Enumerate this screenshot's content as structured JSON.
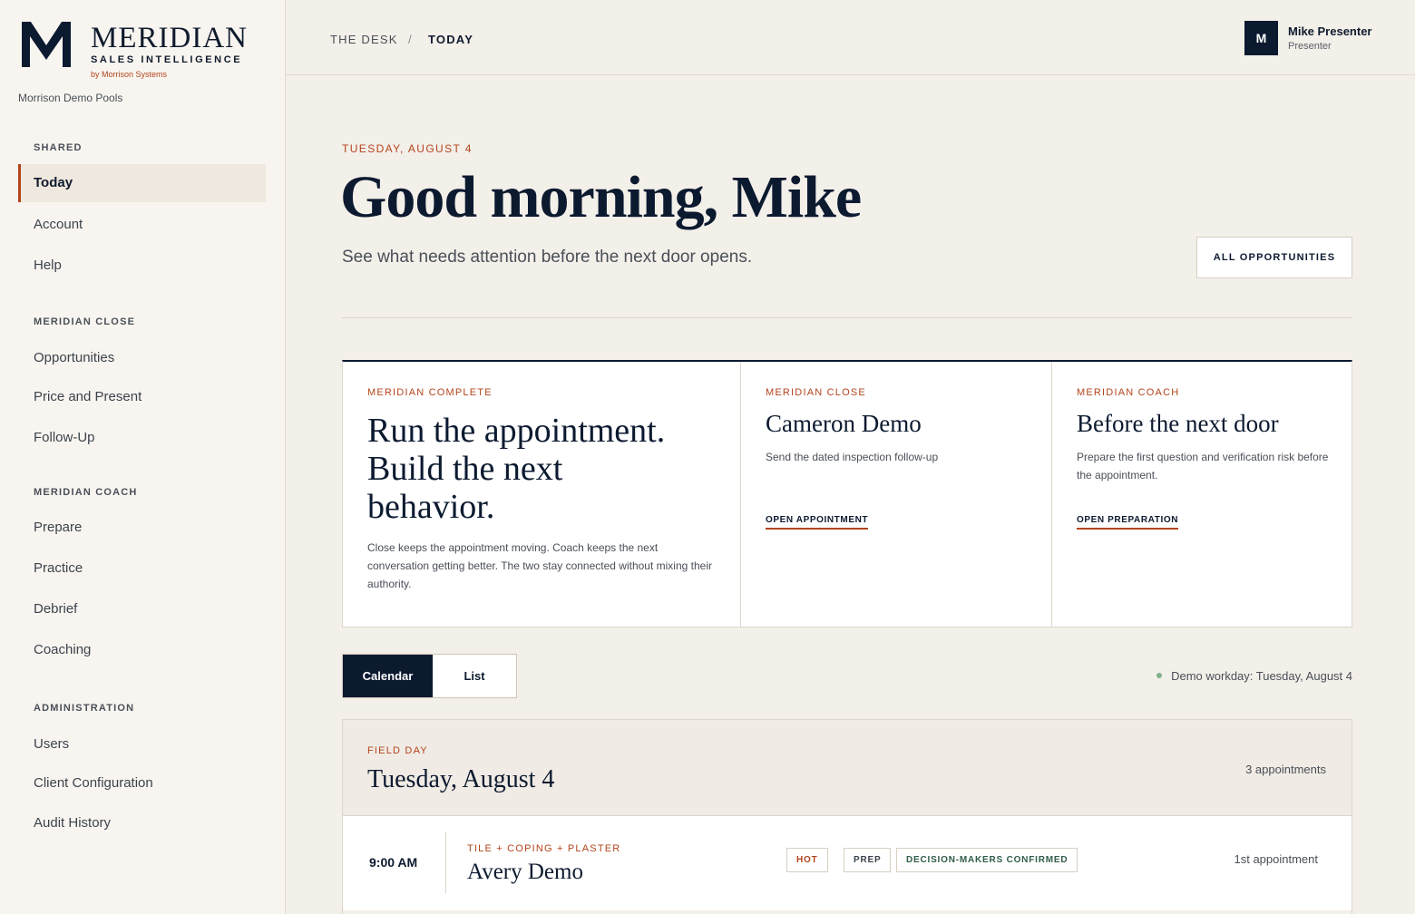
{
  "brand": {
    "name": "MERIDIAN",
    "subtitle": "SALES INTELLIGENCE",
    "by": "by Morrison Systems",
    "org": "Morrison Demo Pools"
  },
  "sidebar": {
    "shared_label": "SHARED",
    "shared": [
      {
        "label": "Today",
        "active": true
      },
      {
        "label": "Account"
      },
      {
        "label": "Help"
      }
    ],
    "close_label": "MERIDIAN CLOSE",
    "close": [
      {
        "label": "Opportunities"
      },
      {
        "label": "Price and Present"
      },
      {
        "label": "Follow-Up"
      }
    ],
    "coach_label": "MERIDIAN COACH",
    "coach": [
      {
        "label": "Prepare"
      },
      {
        "label": "Practice"
      },
      {
        "label": "Debrief"
      },
      {
        "label": "Coaching"
      }
    ],
    "admin_label": "ADMINISTRATION",
    "admin": [
      {
        "label": "Users"
      },
      {
        "label": "Client Configuration"
      },
      {
        "label": "Audit History"
      }
    ]
  },
  "topbar": {
    "breadcrumb": [
      "THE DESK",
      "/",
      "TODAY"
    ],
    "user": {
      "initial": "M",
      "name": "Mike Presenter",
      "role": "Presenter"
    }
  },
  "hero": {
    "date": "TUESDAY, AUGUST 4",
    "greeting": "Good morning, Mike",
    "subline": "See what needs attention before the next door opens.",
    "all_button": "ALL OPPORTUNITIES"
  },
  "cards": [
    {
      "eyebrow": "MERIDIAN COMPLETE",
      "title": "Run the appointment. Build the next behavior.",
      "desc": "Close keeps the appointment moving. Coach keeps the next conversation getting better. The two stay connected without mixing their authority."
    },
    {
      "eyebrow": "MERIDIAN CLOSE",
      "title": "Cameron Demo",
      "desc": "Send the dated inspection follow-up",
      "link": "OPEN APPOINTMENT"
    },
    {
      "eyebrow": "MERIDIAN COACH",
      "title": "Before the next door",
      "desc": "Prepare the first question and verification risk before the appointment.",
      "link": "OPEN PREPARATION"
    }
  ],
  "view_toggle": {
    "calendar": "Calendar",
    "list": "List",
    "selected": "Calendar"
  },
  "workday": {
    "text": "Demo workday: Tuesday, August 4",
    "dot_color": "#7fb38b"
  },
  "day": {
    "eyebrow": "FIELD DAY",
    "title": "Tuesday, August 4",
    "count": "3 appointments",
    "appointments": [
      {
        "time": "9:00 AM",
        "type": "TILE + COPING + PLASTER",
        "name": "Avery Demo",
        "badges": [
          "HOT",
          "PREP",
          "DECISION-MAKERS CONFIRMED"
        ],
        "sequence": "1st appointment"
      }
    ]
  },
  "colors": {
    "navy": "#0c1a30",
    "accent": "#b3441c",
    "background": "#f3efe9"
  }
}
